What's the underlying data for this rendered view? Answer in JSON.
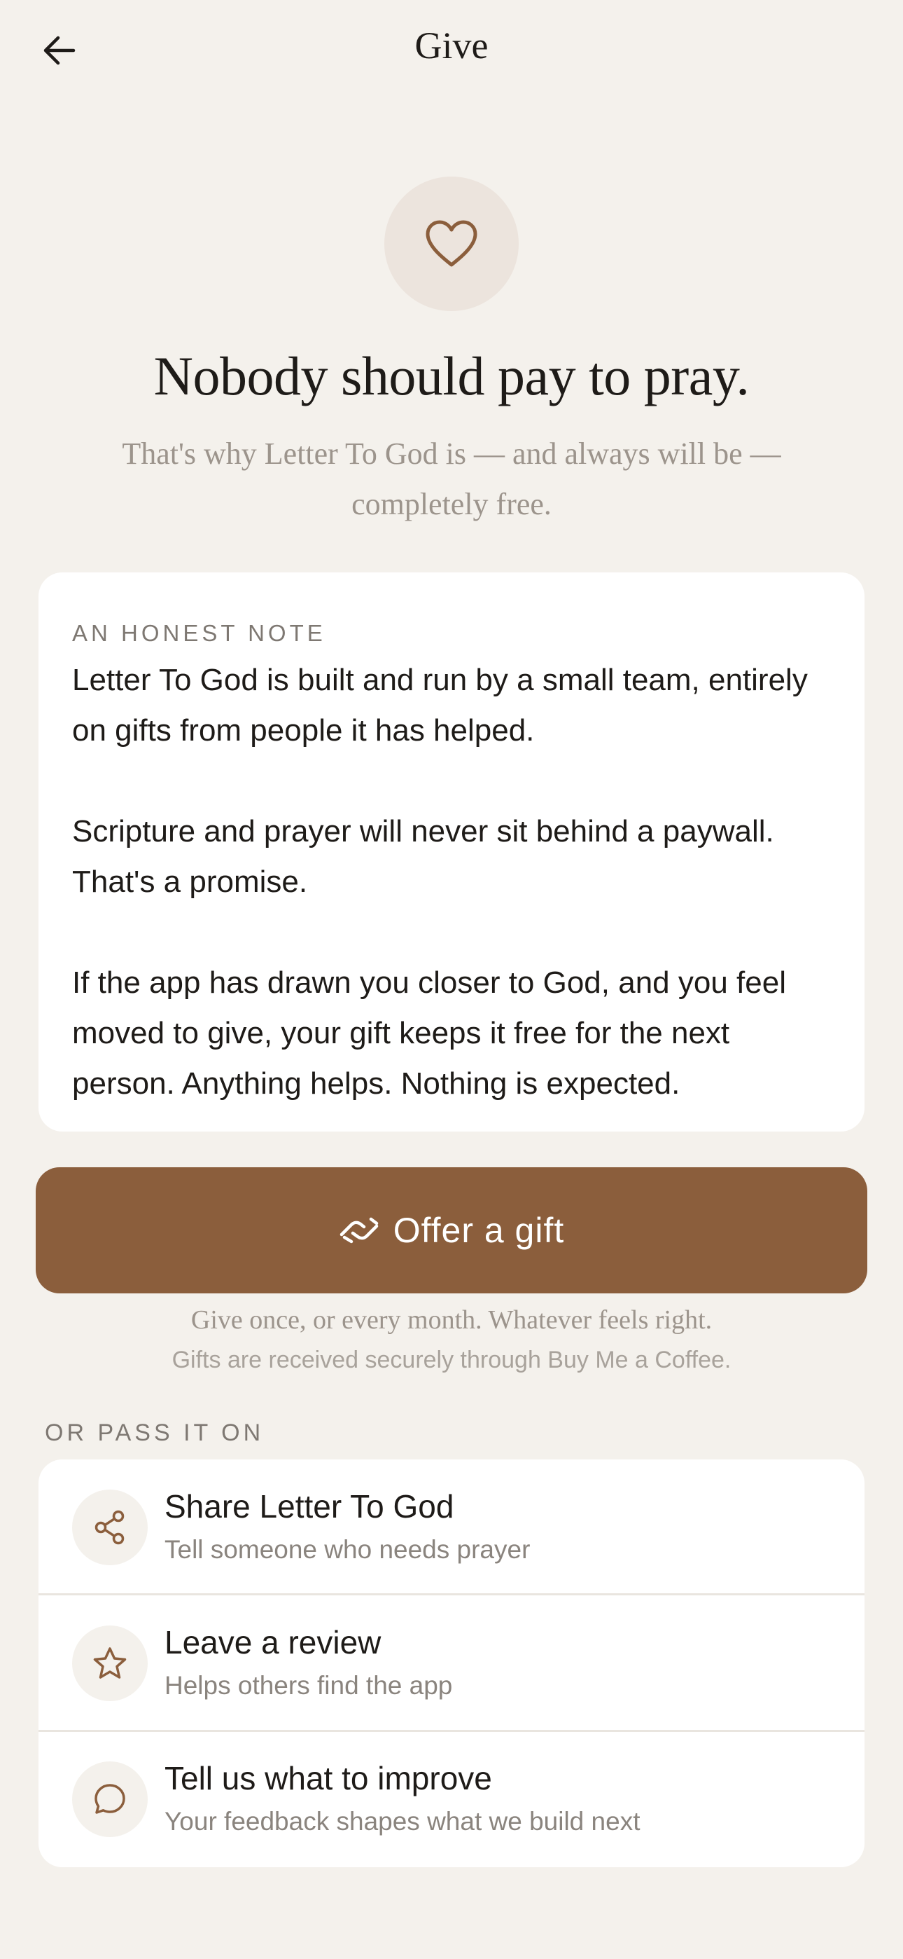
{
  "header": {
    "title": "Give",
    "back_icon": "arrow-left-icon"
  },
  "hero": {
    "icon": "heart-icon",
    "accent_color": "#8B5E3C",
    "headline": "Nobody should pay to pray.",
    "subheadline": "That's why Letter To God is — and always will be — completely free."
  },
  "note": {
    "label": "AN HONEST NOTE",
    "paragraphs": [
      "Letter To God is built and run by a small team, entirely on gifts from people it has helped.",
      "Scripture and prayer will never sit behind a paywall. That's a promise.",
      "If the app has drawn you closer to God, and you feel moved to give, your gift keeps it free for the next person. Anything helps. Nothing is expected."
    ]
  },
  "gift": {
    "button_label": "Offer a gift",
    "button_icon": "handshake-icon",
    "button_color": "#8B5E3C",
    "caption": "Give once, or every month. Whatever feels right.",
    "secure_note": "Gifts are received securely through Buy Me a Coffee."
  },
  "pass_it_on": {
    "label": "OR PASS IT ON",
    "items": [
      {
        "icon": "share-icon",
        "title": "Share Letter To God",
        "subtitle": "Tell someone who needs prayer"
      },
      {
        "icon": "star-icon",
        "title": "Leave a review",
        "subtitle": "Helps others find the app"
      },
      {
        "icon": "message-icon",
        "title": "Tell us what to improve",
        "subtitle": "Your feedback shapes what we build next"
      }
    ]
  }
}
